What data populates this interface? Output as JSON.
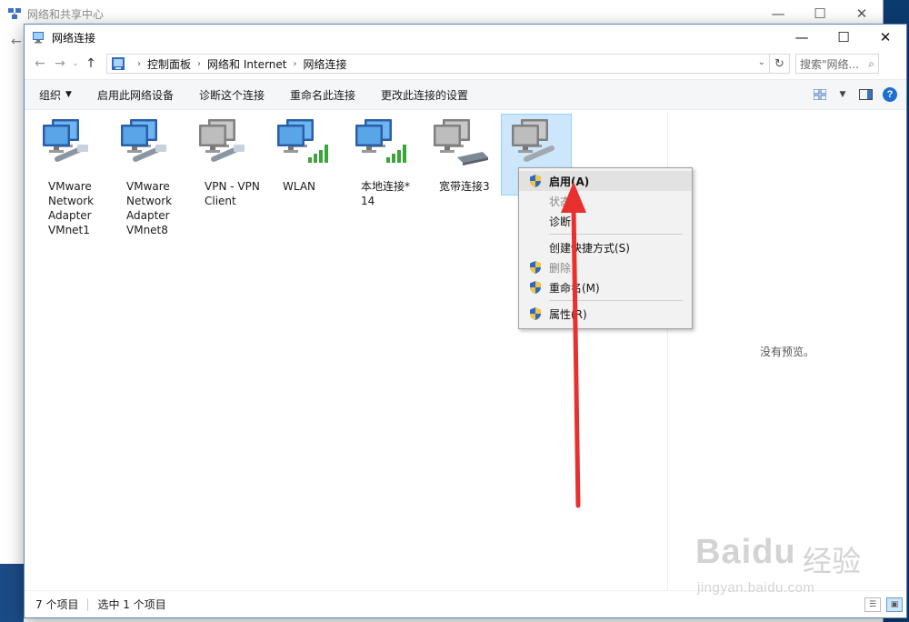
{
  "back_window": {
    "title": "网络和共享中心"
  },
  "window": {
    "title": "网络连接",
    "breadcrumb": [
      "控制面板",
      "网络和 Internet",
      "网络连接"
    ],
    "search_placeholder": "搜索\"网络...",
    "controls": {
      "minimize": "—",
      "maximize": "☐",
      "close": "✕"
    }
  },
  "toolbar": {
    "items": [
      "组织",
      "启用此网络设备",
      "诊断这个连接",
      "重命名此连接",
      "更改此连接的设置"
    ]
  },
  "connections": [
    {
      "label": "VMware\nNetwork\nAdapter\nVMnet1",
      "icon": "network-adapter-icon",
      "selected": false
    },
    {
      "label": "VMware\nNetwork\nAdapter\nVMnet8",
      "icon": "network-adapter-icon",
      "selected": false
    },
    {
      "label": "VPN - VPN\nClient",
      "icon": "vpn-connection-icon",
      "selected": false
    },
    {
      "label": "WLAN",
      "icon": "wlan-signal-icon",
      "selected": false
    },
    {
      "label": "本地连接*\n14",
      "icon": "wlan-signal-icon",
      "selected": false
    },
    {
      "label": "宽带连接3",
      "icon": "broadband-modem-icon",
      "selected": false
    },
    {
      "label": "",
      "icon": "disabled-adapter-icon",
      "selected": true
    }
  ],
  "context_menu": [
    {
      "label": "启用(A)",
      "shield": true,
      "hot": true,
      "disabled": false
    },
    {
      "label": "状态",
      "shield": false,
      "hot": false,
      "disabled": true
    },
    {
      "label": "诊断",
      "shield": false,
      "hot": false,
      "disabled": false
    },
    {
      "separator": true
    },
    {
      "label": "创建快捷方式(S)",
      "shield": false,
      "hot": false,
      "disabled": false
    },
    {
      "label": "删除",
      "shield": true,
      "hot": false,
      "disabled": true
    },
    {
      "label": "重命名(M)",
      "shield": true,
      "hot": false,
      "disabled": false
    },
    {
      "separator": true
    },
    {
      "label": "属性(R)",
      "shield": true,
      "hot": false,
      "disabled": false
    }
  ],
  "preview_text": "没有预览。",
  "status": {
    "count": "7 个项目",
    "selected": "选中 1 个项目"
  },
  "watermark": {
    "logo": "Baidu",
    "cn": "经验",
    "url": "jingyan.baidu.com"
  },
  "colors": {
    "accent": "#1f6fd1",
    "selection": "#cce6fb",
    "arrow": "#e8302e"
  }
}
